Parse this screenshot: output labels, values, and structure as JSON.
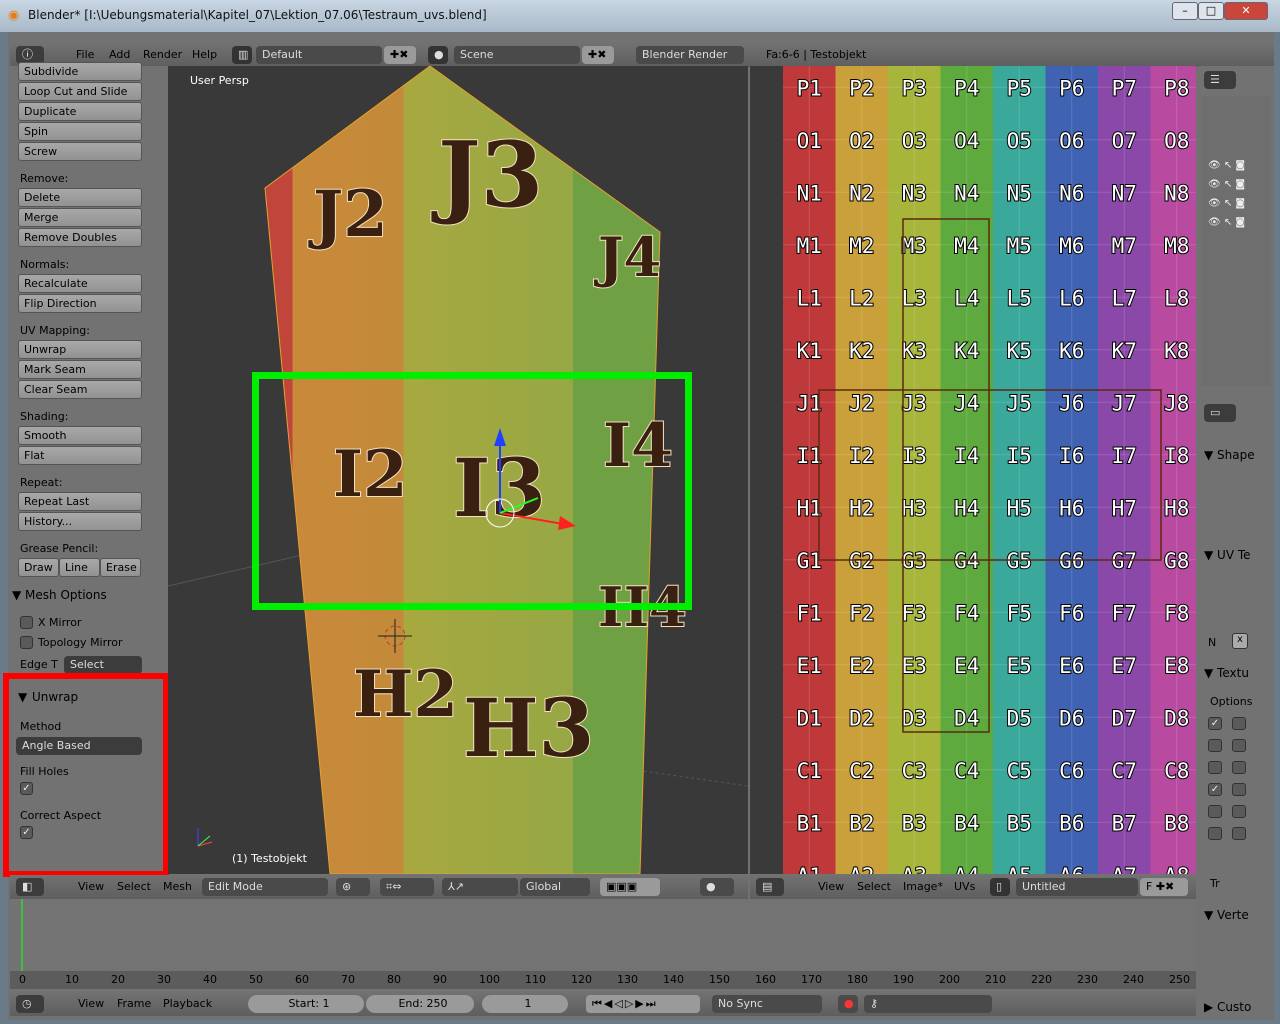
{
  "window": {
    "title": "Blender* [I:\\Uebungsmaterial\\Kapitel_07\\Lektion_07.06\\Testraum_uvs.blend]",
    "min": "–",
    "max": "□",
    "close": "✕"
  },
  "info_header": {
    "menus": [
      "File",
      "Add",
      "Render",
      "Help"
    ],
    "layout": "Default",
    "scene": "Scene",
    "engine": "Blender Render",
    "stats": "Fa:6-6 | Testobjekt"
  },
  "tools": {
    "items_top": [
      "Subdivide",
      "Loop Cut and Slide",
      "Duplicate",
      "Spin",
      "Screw"
    ],
    "remove_label": "Remove:",
    "remove": [
      "Delete",
      "Merge",
      "Remove Doubles"
    ],
    "normals_label": "Normals:",
    "normals": [
      "Recalculate",
      "Flip Direction"
    ],
    "uv_label": "UV Mapping:",
    "uv": [
      "Unwrap",
      "Mark Seam",
      "Clear Seam"
    ],
    "shading_label": "Shading:",
    "shading": [
      "Smooth",
      "Flat"
    ],
    "repeat_label": "Repeat:",
    "repeat": [
      "Repeat Last",
      "History..."
    ],
    "grease_label": "Grease Pencil:",
    "grease": [
      "Draw",
      "Line",
      "Erase"
    ],
    "mesh_options": "Mesh Options",
    "x_mirror": "X Mirror",
    "topology_mirror": "Topology Mirror",
    "edge_t": "Edge T",
    "edge_t_value": "Select"
  },
  "unwrap_panel": {
    "title": "Unwrap",
    "method_label": "Method",
    "method": "Angle Based",
    "fill_holes": "Fill Holes",
    "fill_holes_checked": true,
    "correct_aspect": "Correct Aspect",
    "correct_aspect_checked": true,
    "highlight_color": "#ff0000"
  },
  "viewport": {
    "view_name": "User Persp",
    "object_label": "(1) Testobjekt",
    "face_labels": [
      "J2",
      "J3",
      "J4",
      "I2",
      "I3",
      "I4",
      "H2",
      "H3",
      "H4"
    ],
    "highlight_color": "#00ee00"
  },
  "view3d_header": {
    "menus": [
      "View",
      "Select",
      "Mesh"
    ],
    "mode": "Edit Mode",
    "orientation": "Global"
  },
  "uv_editor": {
    "rows": [
      "P",
      "O",
      "N",
      "M",
      "L",
      "K",
      "J",
      "I",
      "H",
      "G",
      "F",
      "E",
      "D",
      "C",
      "B",
      "A"
    ],
    "columns": [
      "1",
      "2",
      "3",
      "4",
      "5",
      "6",
      "7",
      "8"
    ],
    "column_colors": [
      "#c0393a",
      "#c9a03a",
      "#a7b53b",
      "#5faa3f",
      "#3aa89a",
      "#3f62b2",
      "#8a48a8",
      "#b84aa0"
    ]
  },
  "uv_header": {
    "menus": [
      "View",
      "Select",
      "Image*",
      "UVs"
    ],
    "image": "Untitled",
    "f": "F"
  },
  "timeline": {
    "ticks": [
      0,
      10,
      20,
      30,
      40,
      50,
      60,
      70,
      80,
      90,
      100,
      110,
      120,
      130,
      140,
      150,
      160,
      170,
      180,
      190,
      200,
      210,
      220,
      230,
      240,
      250
    ],
    "current_frame": 0
  },
  "timeline_header": {
    "menus": [
      "View",
      "Frame",
      "Playback"
    ],
    "start": "Start: 1",
    "end": "End: 250",
    "frame": "1",
    "sync": "No Sync"
  },
  "properties": {
    "shape": "Shape",
    "uv_tex": "UV Te",
    "n_label": "N",
    "texture": "Textu",
    "options": "Options",
    "tr": "Tr",
    "vertex": "Verte",
    "custom": "Custo",
    "checks": [
      true,
      false,
      false,
      false,
      false,
      false,
      true,
      false,
      false,
      false,
      false,
      false
    ]
  }
}
